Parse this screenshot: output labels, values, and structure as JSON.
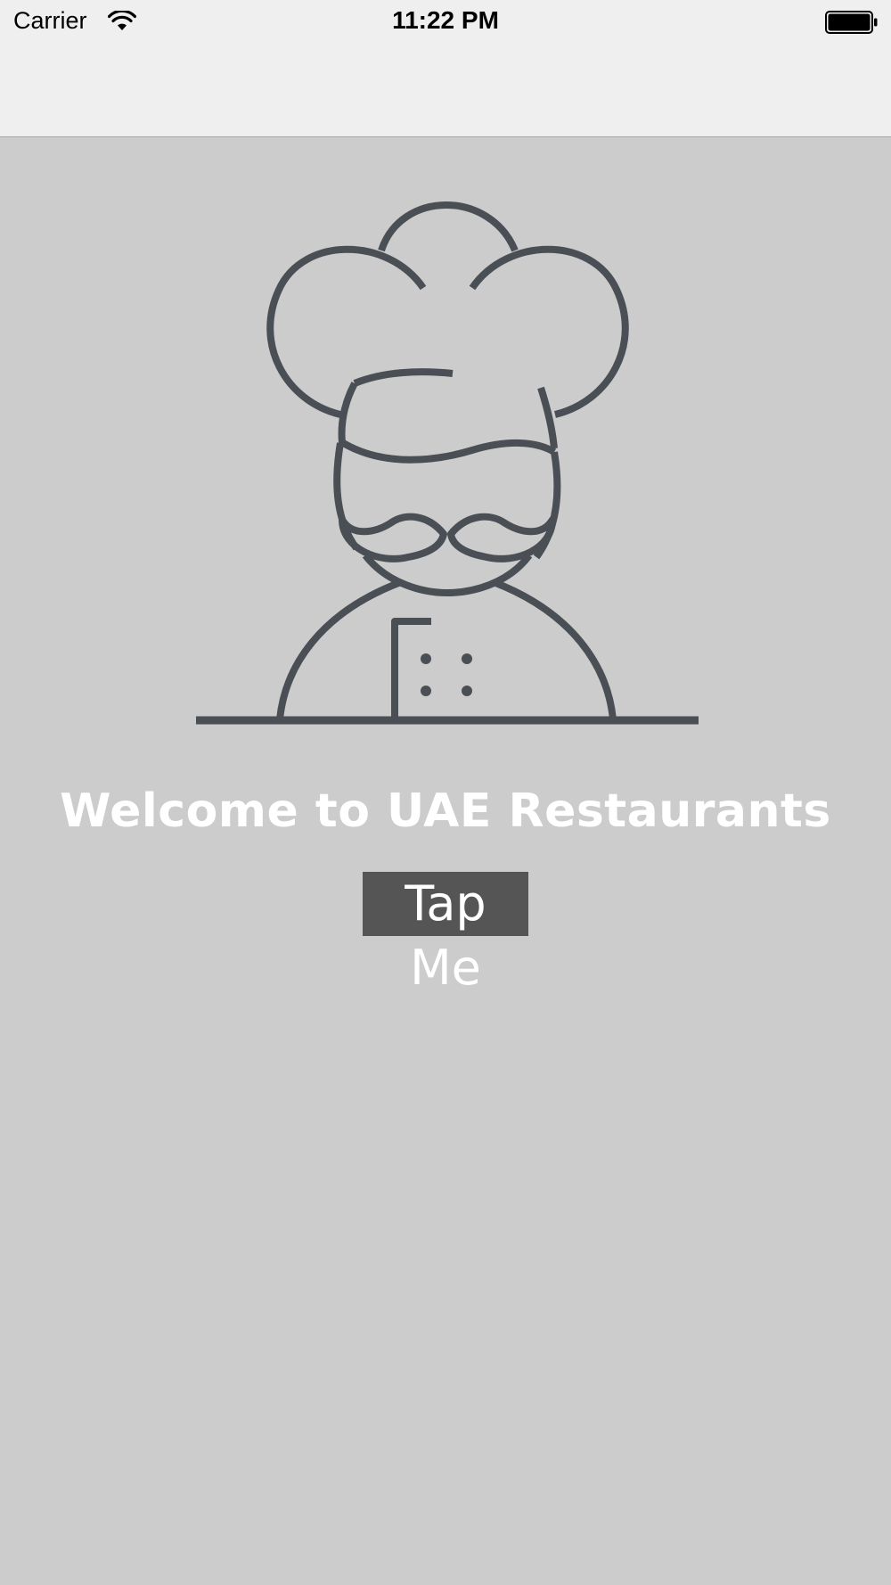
{
  "status_bar": {
    "carrier": "Carrier",
    "time": "11:22 PM"
  },
  "main": {
    "illustration_icon": "chef-icon",
    "welcome_text": "Welcome to UAE Restaurants",
    "button_label": "Tap Me"
  },
  "colors": {
    "background": "#cccccc",
    "nav_background": "#efefef",
    "icon_stroke": "#4a4f56",
    "button_background": "#555555",
    "text": "#ffffff"
  }
}
